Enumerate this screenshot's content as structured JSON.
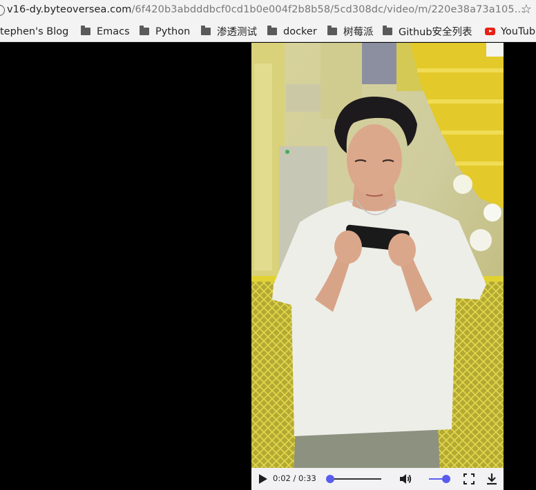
{
  "browser": {
    "url_host": "v16-dy.byteoversea.com",
    "url_path": "/6f420b3abdddbcf0cd1b0e004f2b8b58/5cd308dc/video/m/220e38a73a105...",
    "bookmark_icon": "star-icon",
    "site_info_icon": "info-icon"
  },
  "bookmarks": [
    {
      "label": "tephen's Blog",
      "icon": "none"
    },
    {
      "label": "Emacs",
      "icon": "folder-icon"
    },
    {
      "label": "Python",
      "icon": "folder-icon"
    },
    {
      "label": "渗透测试",
      "icon": "folder-icon"
    },
    {
      "label": "docker",
      "icon": "folder-icon"
    },
    {
      "label": "树莓派",
      "icon": "folder-icon"
    },
    {
      "label": "Github安全列表",
      "icon": "folder-icon"
    },
    {
      "label": "YouTub",
      "icon": "youtube-icon"
    }
  ],
  "video": {
    "current_time": "0:02",
    "duration": "0:33",
    "time_display": "0:02 / 0:33",
    "progress_fraction": 0.06,
    "volume_fraction": 1.0,
    "accent_color": "#5a5cf0",
    "controls": [
      "play-icon",
      "volume-icon",
      "fullscreen-icon",
      "download-icon"
    ]
  }
}
